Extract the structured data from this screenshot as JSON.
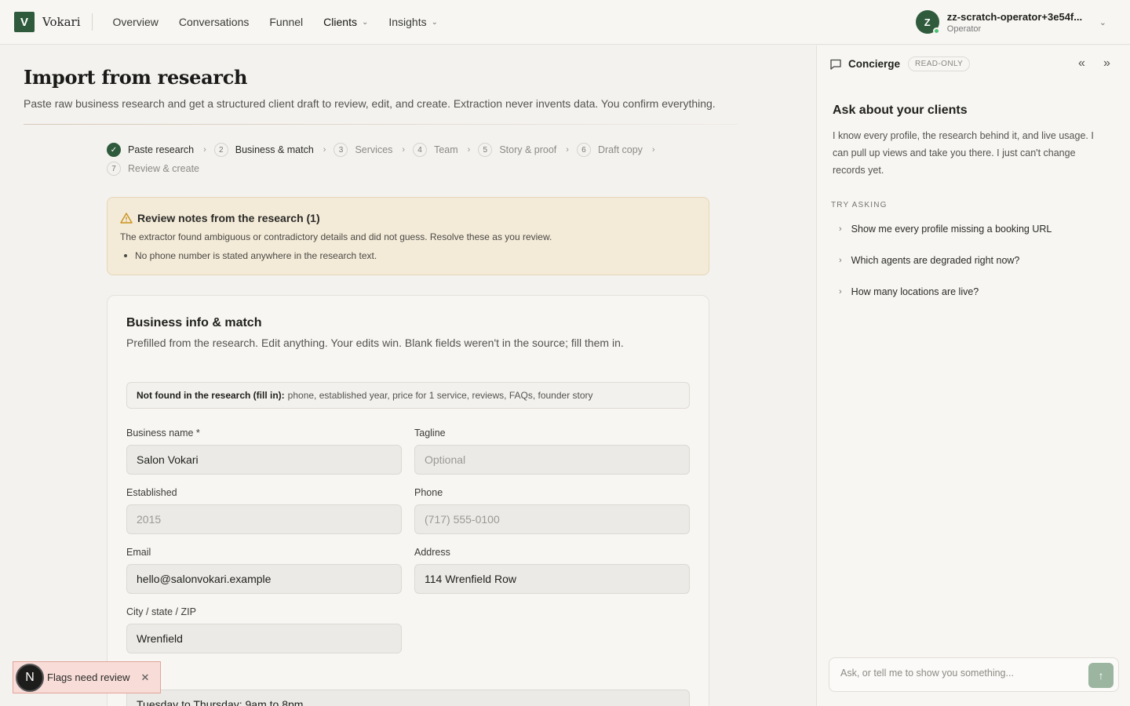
{
  "brand": {
    "mark": "V",
    "name": "Vokari"
  },
  "nav": {
    "items": [
      {
        "label": "Overview"
      },
      {
        "label": "Conversations"
      },
      {
        "label": "Funnel"
      },
      {
        "label": "Clients"
      },
      {
        "label": "Insights"
      }
    ]
  },
  "user": {
    "initial": "Z",
    "name": "zz-scratch-operator+3e54f...",
    "role": "Operator"
  },
  "page": {
    "title": "Import from research",
    "subtitle": "Paste raw business research and get a structured client draft to review, edit, and create. Extraction never invents data. You confirm everything."
  },
  "steps": [
    {
      "num": "✓",
      "label": "Paste research"
    },
    {
      "num": "2",
      "label": "Business & match"
    },
    {
      "num": "3",
      "label": "Services"
    },
    {
      "num": "4",
      "label": "Team"
    },
    {
      "num": "5",
      "label": "Story & proof"
    },
    {
      "num": "6",
      "label": "Draft copy"
    },
    {
      "num": "7",
      "label": "Review & create"
    }
  ],
  "notes": {
    "title": "Review notes from the research (1)",
    "text": "The extractor found ambiguous or contradictory details and did not guess. Resolve these as you review.",
    "items": [
      "No phone number is stated anywhere in the research text."
    ]
  },
  "card": {
    "title": "Business info & match",
    "subtitle": "Prefilled from the research. Edit anything. Your edits win. Blank fields weren't in the source; fill them in.",
    "notfound_label": "Not found in the research (fill in):",
    "notfound_value": "phone, established year, price for 1 service, reviews, FAQs, founder story"
  },
  "fields": {
    "business_name": {
      "label": "Business name *",
      "value": "Salon Vokari",
      "placeholder": ""
    },
    "tagline": {
      "label": "Tagline",
      "value": "",
      "placeholder": "Optional"
    },
    "established": {
      "label": "Established",
      "value": "",
      "placeholder": "2015"
    },
    "phone": {
      "label": "Phone",
      "value": "",
      "placeholder": "(717) 555-0100"
    },
    "email": {
      "label": "Email",
      "value": "hello@salonvokari.example",
      "placeholder": ""
    },
    "address": {
      "label": "Address",
      "value": "114 Wrenfield Row",
      "placeholder": ""
    },
    "city": {
      "label": "City / state / ZIP",
      "value": "Wrenfield",
      "placeholder": ""
    },
    "hours": {
      "value": "Tuesday to Thursday: 9am to 8pm"
    }
  },
  "panel": {
    "name": "Concierge",
    "badge": "READ-ONLY",
    "collapse_glyph": "«",
    "expand_glyph": "»",
    "ask_title": "Ask about your clients",
    "ask_text": "I know every profile, the research behind it, and live usage. I can pull up views and take you there. I just can't change records yet.",
    "try_label": "TRY ASKING",
    "suggestions": [
      "Show me every profile missing a booking URL",
      "Which agents are degraded right now?",
      "How many locations are live?"
    ],
    "composer_placeholder": "Ask, or tell me to show you something..."
  },
  "toast": {
    "initial": "N",
    "text": "Flags need review"
  },
  "colors": {
    "brand_green": "#2f5a3c",
    "notes_bg": "#f3ead8",
    "toast_bg": "#f7dcd8"
  },
  "icons": [
    "check-icon",
    "chevron-down-icon",
    "warning-icon",
    "chat-icon",
    "collapse-icon",
    "expand-icon",
    "arrow-up-icon",
    "close-icon"
  ]
}
